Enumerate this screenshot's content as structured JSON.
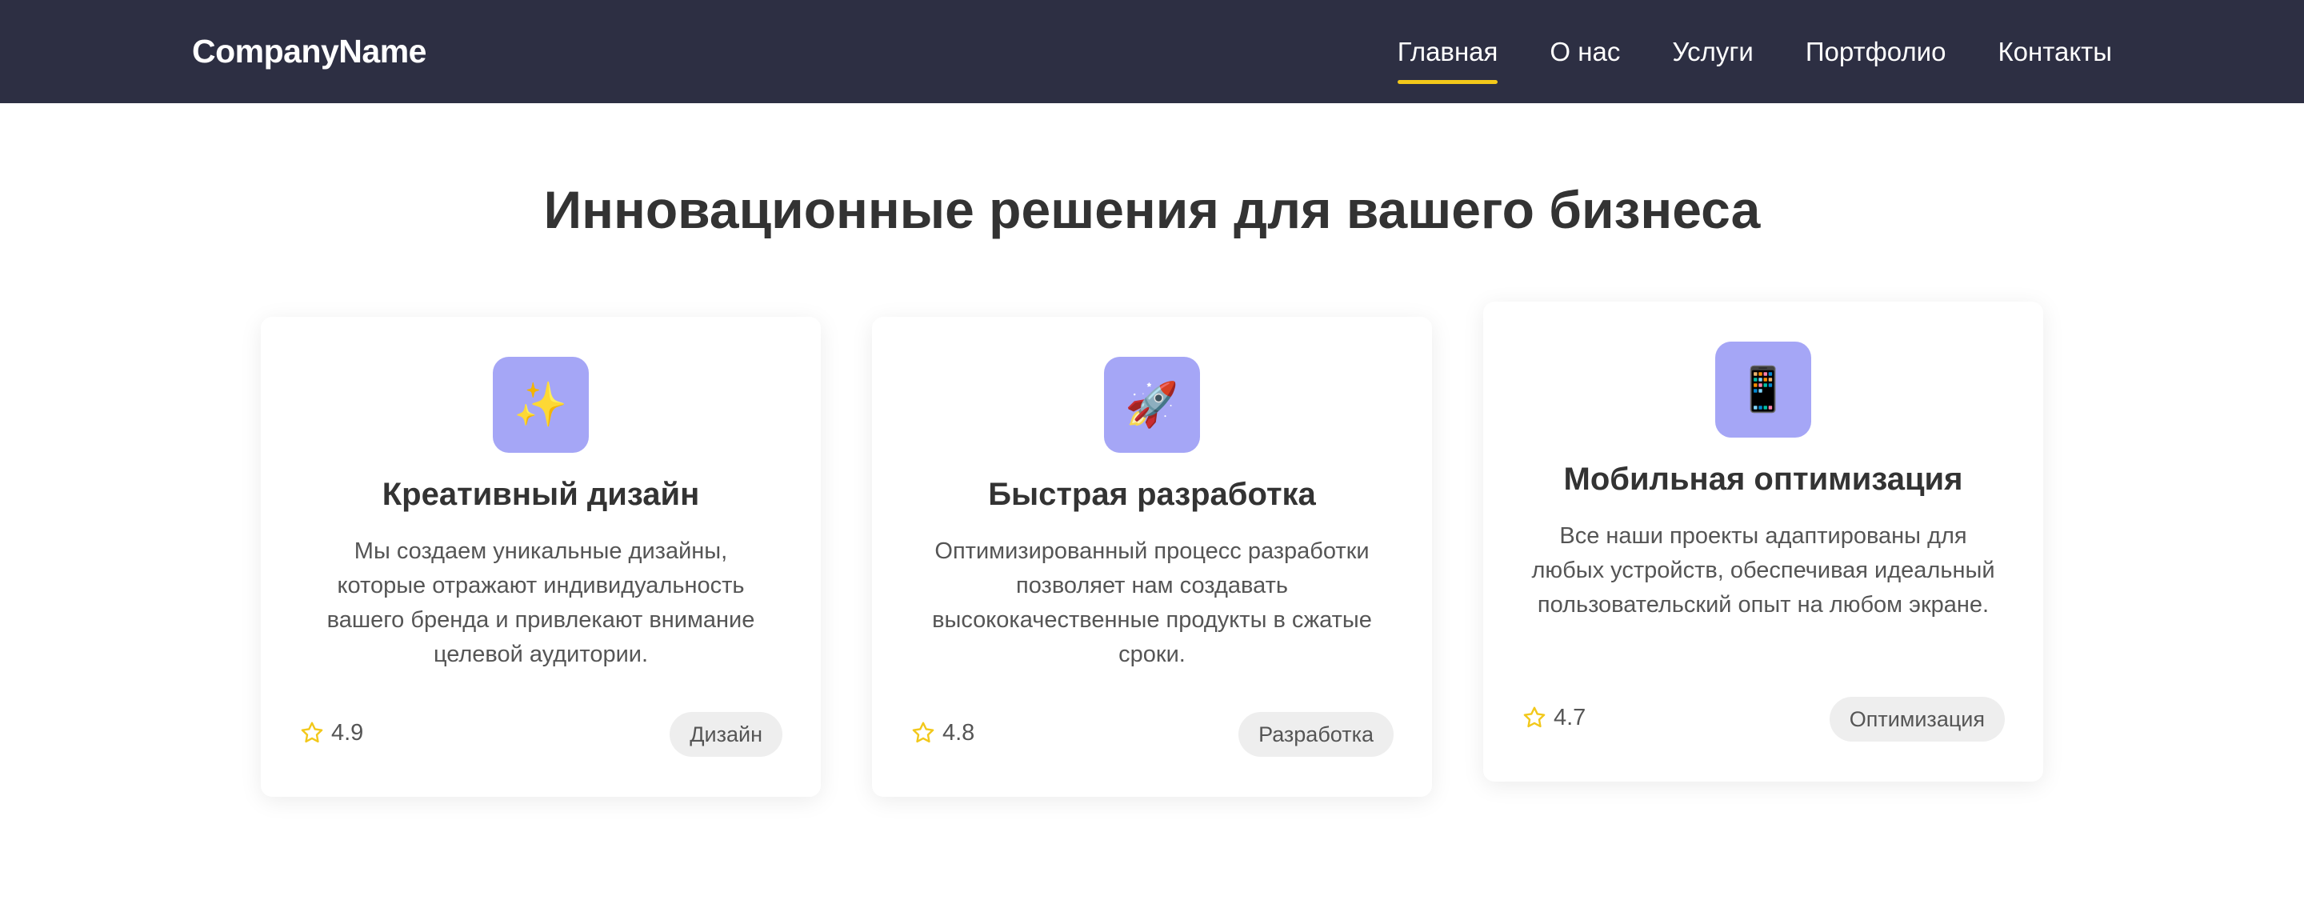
{
  "header": {
    "logo": "CompanyName",
    "nav": [
      {
        "label": "Главная",
        "active": true
      },
      {
        "label": "О нас",
        "active": false
      },
      {
        "label": "Услуги",
        "active": false
      },
      {
        "label": "Портфолио",
        "active": false
      },
      {
        "label": "Контакты",
        "active": false
      }
    ],
    "active_underline_color": "#f2c81a",
    "background_color": "#2d2f43"
  },
  "hero": {
    "title": "Инновационные решения для вашего бизнеса"
  },
  "cards": [
    {
      "icon": "sparkles-icon",
      "icon_glyph": "✨",
      "title": "Креативный дизайн",
      "description": "Мы создаем уникальные дизайны, которые отражают индивидуальность вашего бренда и привлекают внимание целевой аудитории.",
      "rating": "4.9",
      "tag": "Дизайн"
    },
    {
      "icon": "rocket-icon",
      "icon_glyph": "🚀",
      "title": "Быстрая разработка",
      "description": "Оптимизированный процесс разработки позволяет нам создавать высококачественные продукты в сжатые сроки.",
      "rating": "4.8",
      "tag": "Разработка"
    },
    {
      "icon": "mobile-phone-icon",
      "icon_glyph": "📱",
      "title": "Мобильная оптимизация",
      "description": "Все наши проекты адаптированы для любых устройств, обеспечивая идеальный пользовательский опыт на любом экране.",
      "rating": "4.7",
      "tag": "Оптимизация"
    }
  ],
  "colors": {
    "icon_background": "#a5a6f6",
    "star": "#f2c81a",
    "tag_background": "#eeeeee"
  }
}
